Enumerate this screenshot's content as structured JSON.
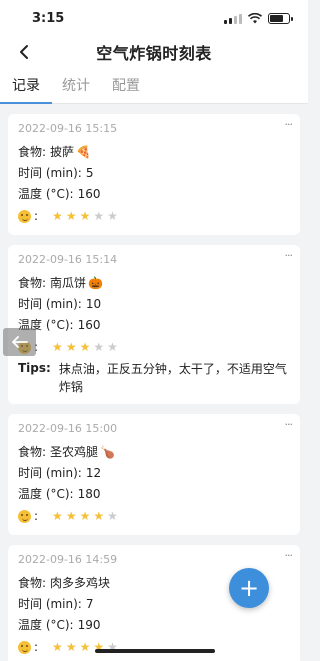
{
  "status": {
    "time": "3:15"
  },
  "nav": {
    "title": "空气炸锅时刻表"
  },
  "tabs": [
    {
      "label": "记录",
      "active": true
    },
    {
      "label": "统计",
      "active": false
    },
    {
      "label": "配置",
      "active": false
    }
  ],
  "labels": {
    "food": "食物:",
    "time": "时间 (min):",
    "temp": "温度 (°C):",
    "rating": ":",
    "tips": "Tips:",
    "more": "···"
  },
  "records": [
    {
      "date": "2022-09-16 15:15",
      "food": "披萨",
      "food_icon": "pizza-icon",
      "food_emoji": "🍕",
      "minutes": "5",
      "temp": "160",
      "rating": 3,
      "tips": ""
    },
    {
      "date": "2022-09-16 15:14",
      "food": "南瓜饼",
      "food_icon": "pumpkin-icon",
      "food_emoji": "🎃",
      "minutes": "10",
      "temp": "160",
      "rating": 3,
      "tips": "抹点油，正反五分钟，太干了，不适用空气炸锅"
    },
    {
      "date": "2022-09-16 15:00",
      "food": "圣农鸡腿",
      "food_icon": "drumstick-icon",
      "food_emoji": "🍗",
      "minutes": "12",
      "temp": "180",
      "rating": 4,
      "tips": ""
    },
    {
      "date": "2022-09-16 14:59",
      "food": "肉多多鸡块",
      "food_icon": "",
      "food_emoji": "",
      "minutes": "7",
      "temp": "190",
      "rating": 4,
      "tips": ""
    }
  ],
  "fab": {
    "label": "+"
  },
  "colors": {
    "accent": "#3d8fdc",
    "star_on": "#f5c038",
    "star_off": "#cccccc"
  }
}
